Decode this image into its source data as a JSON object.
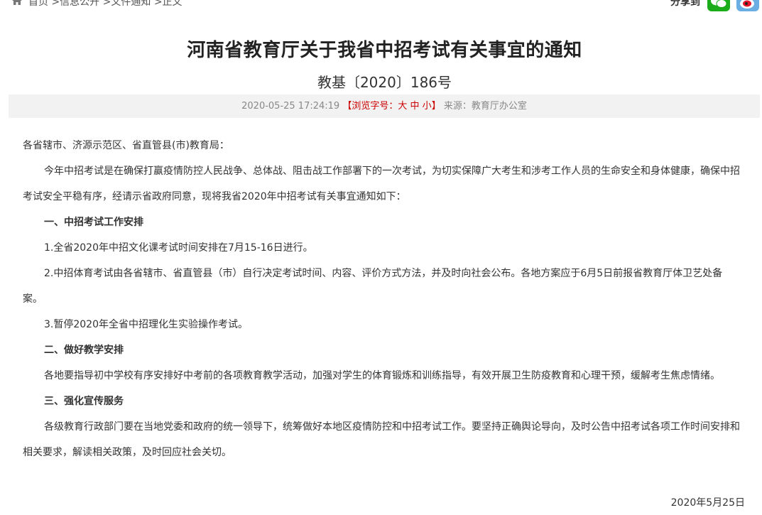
{
  "breadcrumb": {
    "home": "首页",
    "level1": ">信息公开",
    "level2": ">文件通知",
    "level3": ">正文"
  },
  "share": {
    "label": "分享到",
    "icons": [
      "wechat-icon",
      "weibo-icon"
    ]
  },
  "article": {
    "title": "河南省教育厅关于我省中招考试有关事宜的通知",
    "doc_number": "教基〔2020〕186号",
    "meta": {
      "datetime": "2020-05-25 17:24:19",
      "font_size_prefix": "【浏览字号：",
      "font_size_large": "大",
      "font_size_medium": "中",
      "font_size_small": "小",
      "font_size_suffix": "】",
      "source": "来源：教育厅办公室"
    },
    "salutation": "各省辖市、济源示范区、省直管县(市)教育局：",
    "paragraphs": [
      "今年中招考试是在确保打赢疫情防控人民战争、总体战、阻击战工作部署下的一次考试，为切实保障广大考生和涉考工作人员的生命安全和身体健康，确保中招考试安全平稳有序，经请示省政府同意，现将我省2020年中招考试有关事宜通知如下：",
      "一、中招考试工作安排",
      "1.全省2020年中招文化课考试时间安排在7月15-16日进行。",
      "2.中招体育考试由各省辖市、省直管县（市）自行决定考试时间、内容、评价方式方法，并及时向社会公布。各地方案应于6月5日前报省教育厅体卫艺处备案。",
      "3.暂停2020年全省中招理化生实验操作考试。",
      "二、做好教学安排",
      "各地要指导初中学校有序安排好中考前的各项教育教学活动，加强对学生的体育锻炼和训练指导，有效开展卫生防疫教育和心理干预，缓解考生焦虑情绪。",
      "三、强化宣传服务",
      "各级教育行政部门要在当地党委和政府的统一领导下，统筹做好本地区疫情防控和中招考试工作。要坚持正确舆论导向，及时公告中招考试各项工作时间安排和相关要求，解读相关政策，及时回应社会关切。"
    ],
    "date_signature": "2020年5月25日"
  },
  "colors": {
    "meta_bg": "#f2f2f2",
    "meta_text": "#888888",
    "font_size_accent": "#cc0000",
    "wechat_green": "#1aad19",
    "weibo_blue": "#6aaee3"
  }
}
